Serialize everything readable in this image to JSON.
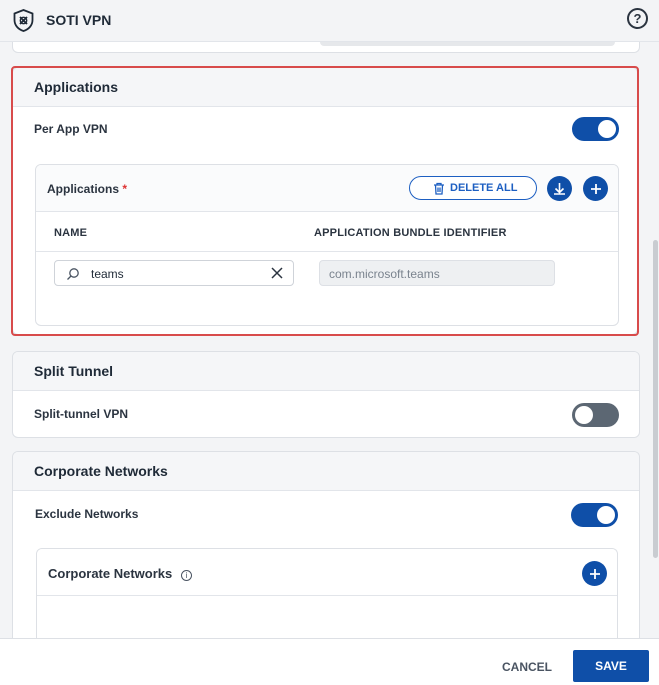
{
  "header": {
    "app_title": "SOTI VPN",
    "help_glyph": "?"
  },
  "applications_section": {
    "title": "Applications",
    "per_app_vpn_label": "Per App VPN",
    "per_app_vpn_on": true,
    "subpanel": {
      "title": "Applications",
      "required_mark": "*",
      "delete_all_label": "DELETE ALL",
      "columns": [
        "NAME",
        "APPLICATION BUNDLE IDENTIFIER"
      ],
      "rows": [
        {
          "name": "teams",
          "bundle_id": "com.microsoft.teams"
        }
      ]
    }
  },
  "split_tunnel_section": {
    "title": "Split Tunnel",
    "split_tunnel_label": "Split-tunnel VPN",
    "split_tunnel_on": false
  },
  "corporate_networks_section": {
    "title": "Corporate Networks",
    "exclude_networks_label": "Exclude Networks",
    "exclude_networks_on": true,
    "subpanel_title": "Corporate Networks",
    "info_glyph": "i"
  },
  "footer": {
    "cancel_label": "CANCEL",
    "save_label": "SAVE"
  },
  "colors": {
    "primary": "#0f4fa8",
    "highlight_border": "#d84b4b",
    "toggle_off": "#5c6773"
  }
}
